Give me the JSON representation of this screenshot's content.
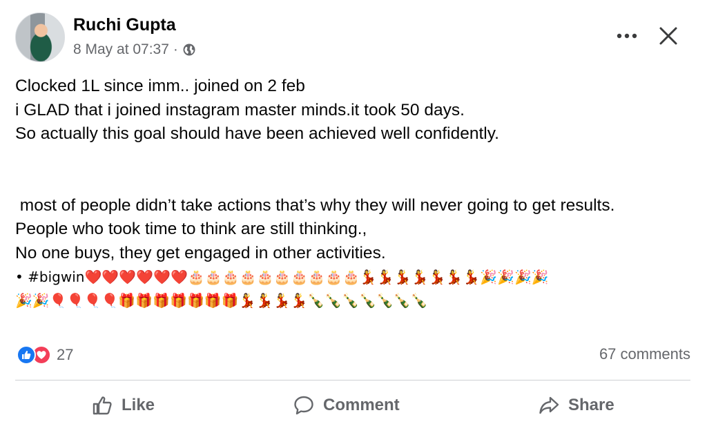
{
  "author": {
    "name": "Ruchi Gupta",
    "timestamp": "8 May at 07:37",
    "separator": "·",
    "privacy_icon": "globe-icon"
  },
  "header_actions": {
    "more_label": "•••",
    "close_icon": "close-icon"
  },
  "post": {
    "lines": [
      "Clocked 1L since imm.. joined on 2 feb",
      "i GLAD that i joined instagram master minds.it took 50 days.",
      "So actually this goal should have been achieved well confidently.",
      " most of people didn’t take actions that’s why they will never going to get results.",
      "People who took time to think are still thinking.,",
      "No one buys, they get engaged in other activities."
    ],
    "hashtag_line": "• #bigwin❤️❤️❤️❤️❤️❤️🎂🎂🎂🎂🎂🎂🎂🎂🎂🎂💃💃💃💃💃💃💃🎉🎉🎉🎉",
    "emoji_line": "🎉🎉🎈🎈🎈🎈🎁🎁🎁🎁🎁🎁🎁💃💃💃💃🍾🍾🍾🍾🍾🍾🍾"
  },
  "stats": {
    "reaction_count": "27",
    "reaction_types": [
      "like",
      "love"
    ],
    "comments": "67 comments"
  },
  "actions": {
    "like": "Like",
    "comment": "Comment",
    "share": "Share"
  },
  "colors": {
    "facebook_blue": "#1877f2",
    "love_red": "#f33e58",
    "secondary_text": "#65676b"
  }
}
